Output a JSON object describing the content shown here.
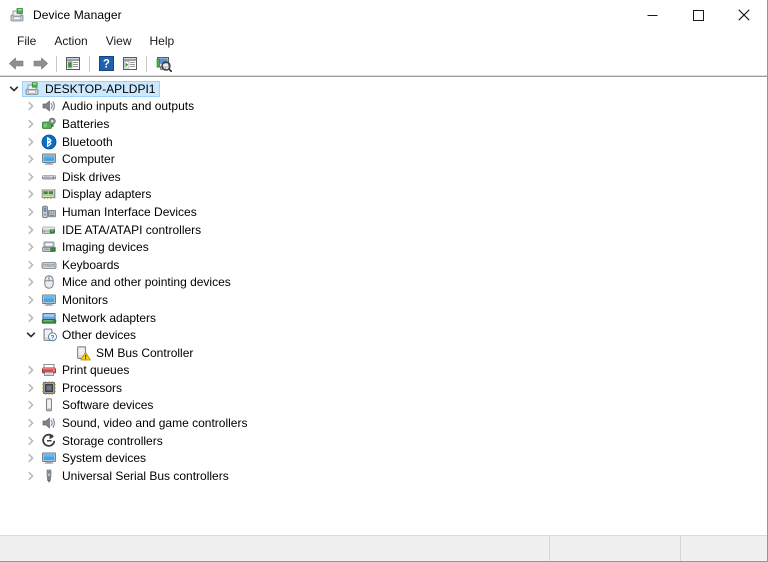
{
  "window": {
    "title": "Device Manager",
    "title_icon": "device-manager-icon",
    "caption": {
      "minimize": "minimize-icon",
      "maximize": "maximize-icon",
      "close": "close-icon"
    }
  },
  "menubar": {
    "items": [
      {
        "label": "File"
      },
      {
        "label": "Action"
      },
      {
        "label": "View"
      },
      {
        "label": "Help"
      }
    ]
  },
  "toolbar": {
    "buttons": [
      {
        "name": "back-button",
        "icon": "back-arrow-icon"
      },
      {
        "name": "forward-button",
        "icon": "forward-arrow-icon"
      },
      {
        "name": "separator-1",
        "icon": "separator"
      },
      {
        "name": "properties-button",
        "icon": "properties-window-icon"
      },
      {
        "name": "separator-2",
        "icon": "separator"
      },
      {
        "name": "help-button",
        "icon": "help-question-icon"
      },
      {
        "name": "show-hide-console-tree-button",
        "icon": "console-tree-icon"
      },
      {
        "name": "separator-3",
        "icon": "separator"
      },
      {
        "name": "scan-for-hardware-changes-button",
        "icon": "scan-hardware-icon"
      }
    ]
  },
  "tree": {
    "rows": [
      {
        "label": "DESKTOP-APLDPI1",
        "level": 0,
        "twisty": "expanded",
        "icon": "computer-root-icon",
        "selected": true,
        "name": "tree-item-desktop-apldpi1"
      },
      {
        "label": "Audio inputs and outputs",
        "level": 1,
        "twisty": "collapsed",
        "icon": "speaker-icon",
        "selected": false,
        "name": "tree-item-audio-inputs-and-outputs"
      },
      {
        "label": "Batteries",
        "level": 1,
        "twisty": "collapsed",
        "icon": "battery-icon",
        "selected": false,
        "name": "tree-item-batteries"
      },
      {
        "label": "Bluetooth",
        "level": 1,
        "twisty": "collapsed",
        "icon": "bluetooth-icon",
        "selected": false,
        "name": "tree-item-bluetooth"
      },
      {
        "label": "Computer",
        "level": 1,
        "twisty": "collapsed",
        "icon": "monitor-icon",
        "selected": false,
        "name": "tree-item-computer"
      },
      {
        "label": "Disk drives",
        "level": 1,
        "twisty": "collapsed",
        "icon": "disk-drive-icon",
        "selected": false,
        "name": "tree-item-disk-drives"
      },
      {
        "label": "Display adapters",
        "level": 1,
        "twisty": "collapsed",
        "icon": "display-adapter-icon",
        "selected": false,
        "name": "tree-item-display-adapters"
      },
      {
        "label": "Human Interface Devices",
        "level": 1,
        "twisty": "collapsed",
        "icon": "hid-icon",
        "selected": false,
        "name": "tree-item-human-interface-devices"
      },
      {
        "label": "IDE ATA/ATAPI controllers",
        "level": 1,
        "twisty": "collapsed",
        "icon": "ide-controller-icon",
        "selected": false,
        "name": "tree-item-ide-ata-atapi-controllers"
      },
      {
        "label": "Imaging devices",
        "level": 1,
        "twisty": "collapsed",
        "icon": "imaging-device-icon",
        "selected": false,
        "name": "tree-item-imaging-devices"
      },
      {
        "label": "Keyboards",
        "level": 1,
        "twisty": "collapsed",
        "icon": "keyboard-icon",
        "selected": false,
        "name": "tree-item-keyboards"
      },
      {
        "label": "Mice and other pointing devices",
        "level": 1,
        "twisty": "collapsed",
        "icon": "mouse-icon",
        "selected": false,
        "name": "tree-item-mice-and-other-pointing-devices"
      },
      {
        "label": "Monitors",
        "level": 1,
        "twisty": "collapsed",
        "icon": "monitor-icon",
        "selected": false,
        "name": "tree-item-monitors"
      },
      {
        "label": "Network adapters",
        "level": 1,
        "twisty": "collapsed",
        "icon": "network-adapter-icon",
        "selected": false,
        "name": "tree-item-network-adapters"
      },
      {
        "label": "Other devices",
        "level": 1,
        "twisty": "expanded",
        "icon": "unknown-device-icon",
        "selected": false,
        "name": "tree-item-other-devices"
      },
      {
        "label": "SM Bus Controller",
        "level": 2,
        "twisty": "none",
        "icon": "unknown-device-warning-icon",
        "selected": false,
        "name": "tree-item-sm-bus-controller"
      },
      {
        "label": "Print queues",
        "level": 1,
        "twisty": "collapsed",
        "icon": "printer-icon",
        "selected": false,
        "name": "tree-item-print-queues"
      },
      {
        "label": "Processors",
        "level": 1,
        "twisty": "collapsed",
        "icon": "processor-icon",
        "selected": false,
        "name": "tree-item-processors"
      },
      {
        "label": "Software devices",
        "level": 1,
        "twisty": "collapsed",
        "icon": "software-device-icon",
        "selected": false,
        "name": "tree-item-software-devices"
      },
      {
        "label": "Sound, video and game controllers",
        "level": 1,
        "twisty": "collapsed",
        "icon": "speaker-icon",
        "selected": false,
        "name": "tree-item-sound-video-and-game-controllers"
      },
      {
        "label": "Storage controllers",
        "level": 1,
        "twisty": "collapsed",
        "icon": "storage-controller-icon",
        "selected": false,
        "name": "tree-item-storage-controllers"
      },
      {
        "label": "System devices",
        "level": 1,
        "twisty": "collapsed",
        "icon": "monitor-icon",
        "selected": false,
        "name": "tree-item-system-devices"
      },
      {
        "label": "Universal Serial Bus controllers",
        "level": 1,
        "twisty": "collapsed",
        "icon": "usb-icon",
        "selected": false,
        "name": "tree-item-universal-serial-bus-controllers"
      }
    ]
  },
  "statusbar": {
    "pane1": "",
    "pane2": "",
    "pane3": ""
  },
  "colors": {
    "selection_fill": "#cce8ff",
    "selection_border": "#99d1ff",
    "window_border": "#6f9fd0",
    "warning": "#ffd800",
    "accent_blue": "#0078d7"
  }
}
